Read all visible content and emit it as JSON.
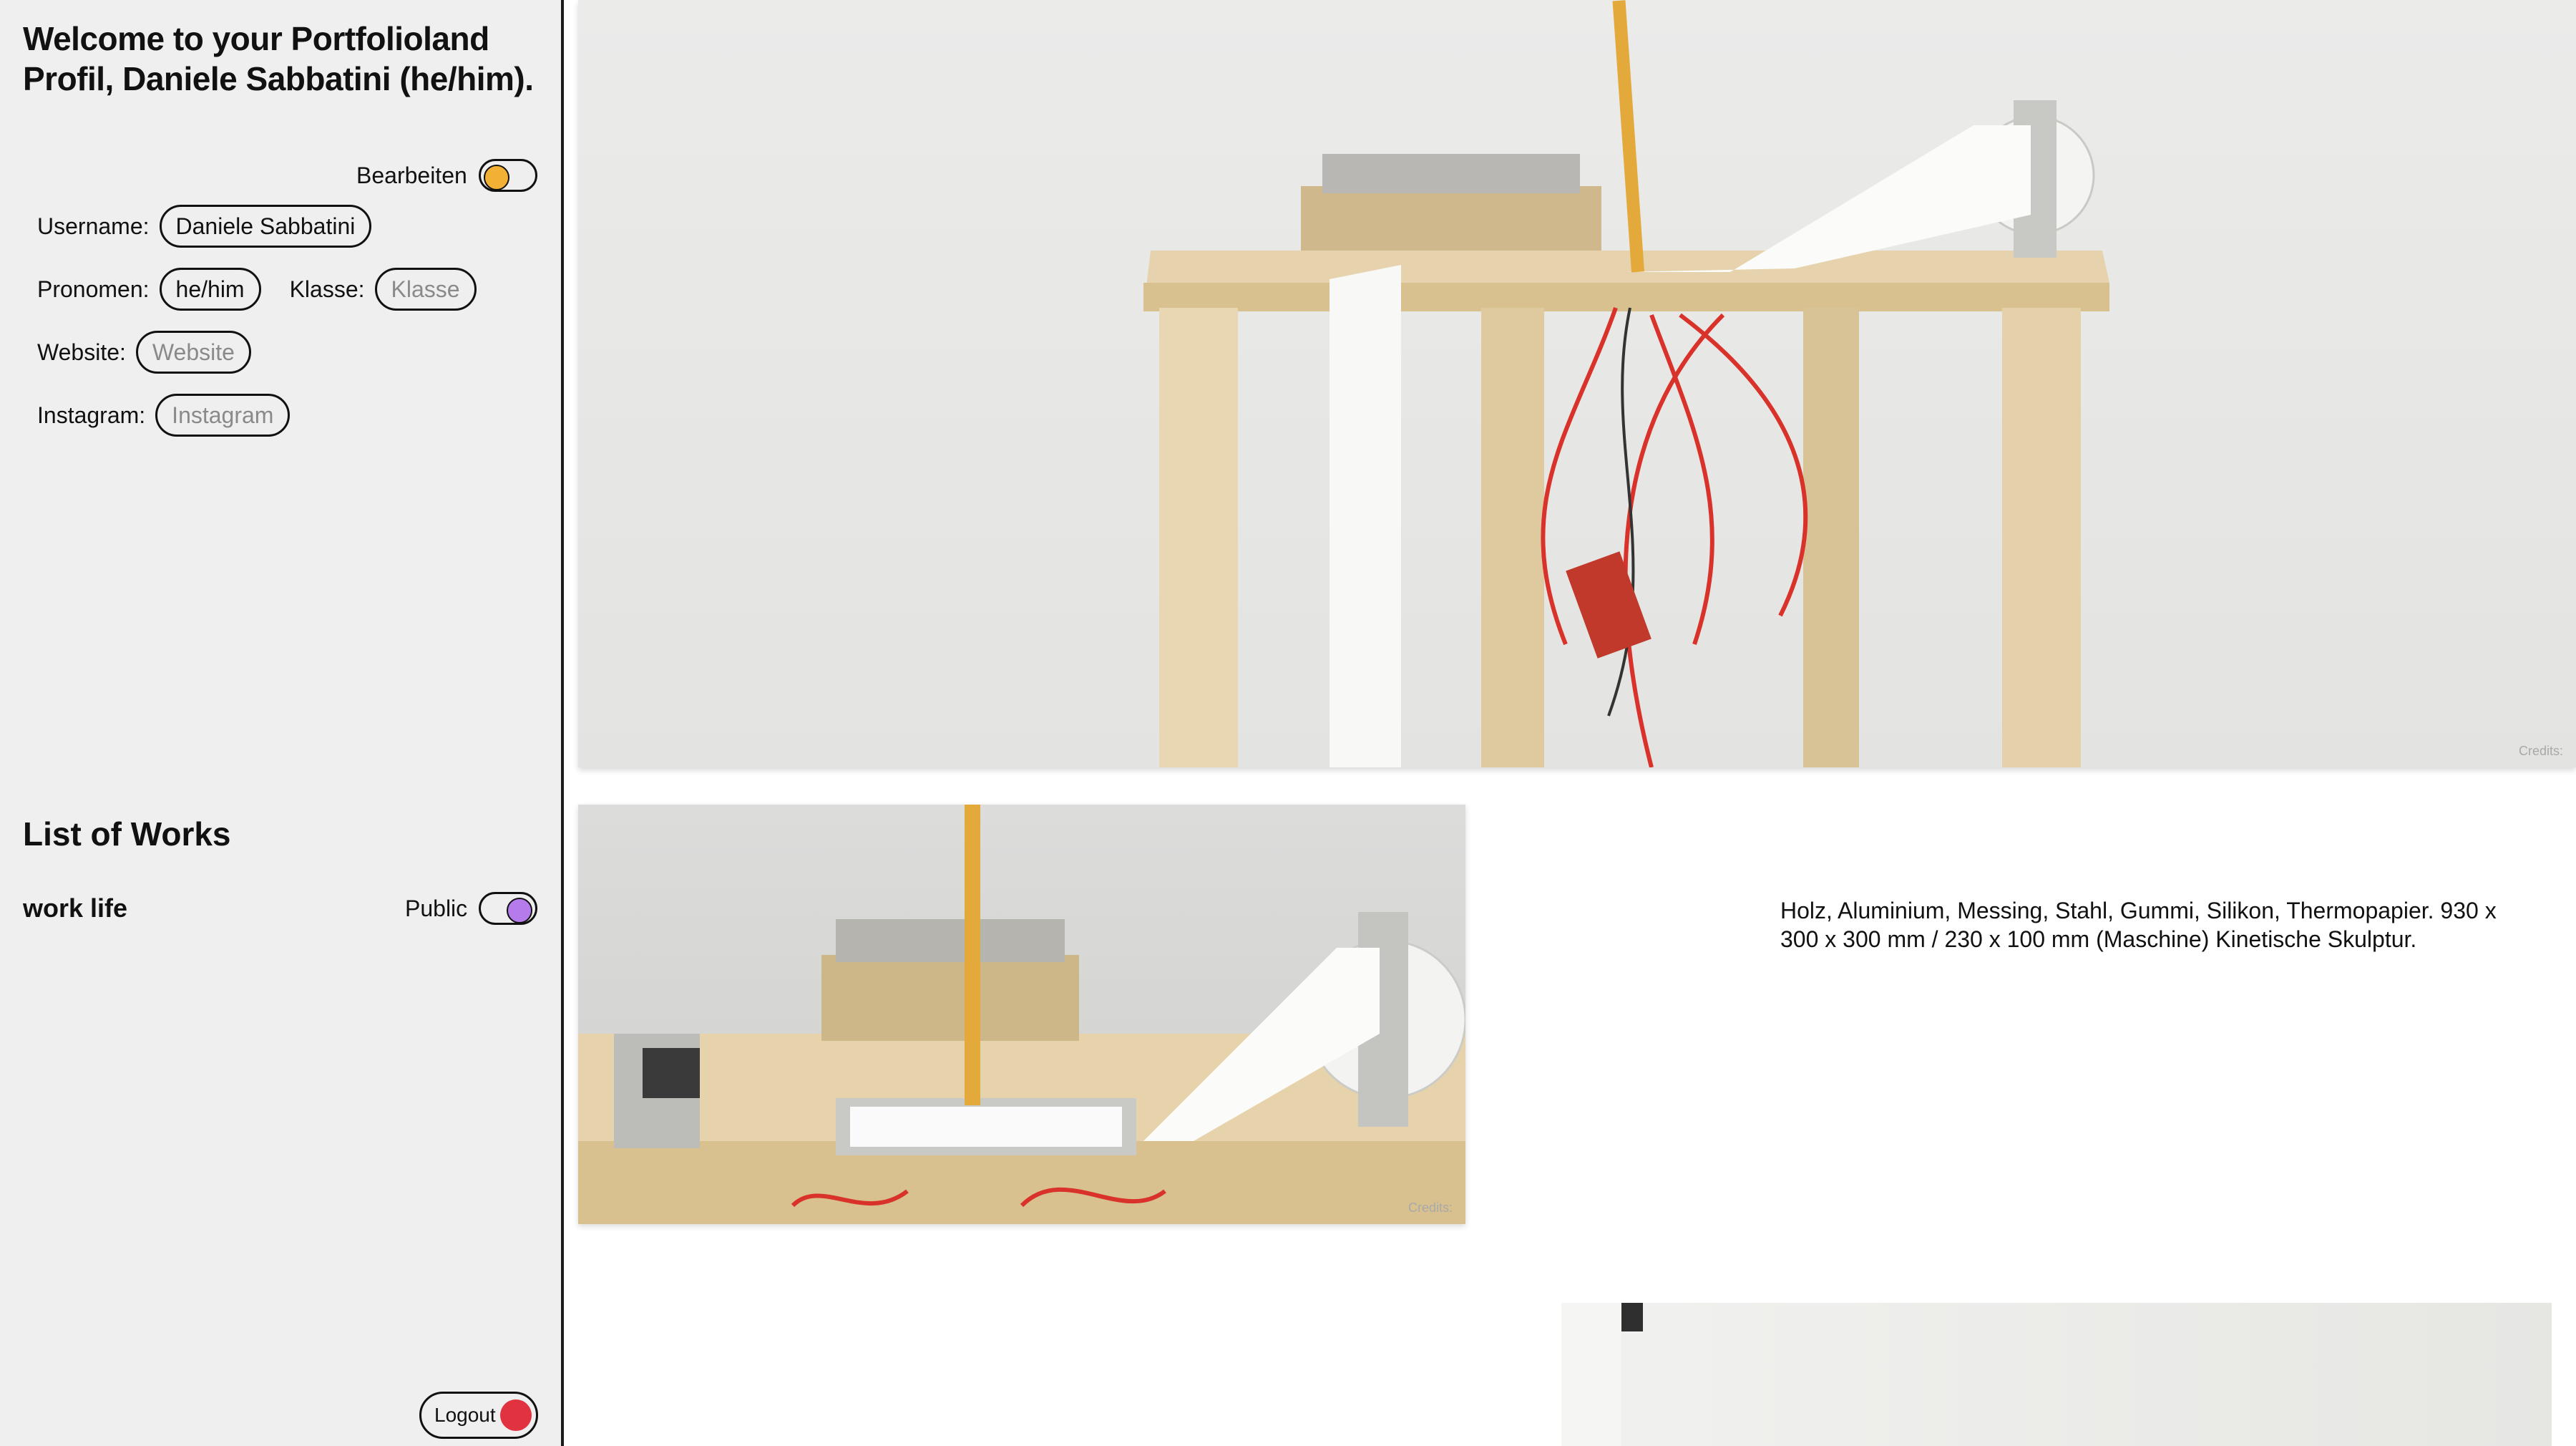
{
  "sidebar": {
    "welcome": "Welcome to your Portfolioland Profil, Daniele Sabbatini (he/him).",
    "edit_toggle": {
      "label": "Bearbeiten",
      "on": false,
      "knob_color": "#f2b134"
    },
    "fields": {
      "username": {
        "label": "Username:",
        "value": "Daniele Sabbatini"
      },
      "pronouns": {
        "label": "Pronomen:",
        "value": "he/him"
      },
      "klasse": {
        "label": "Klasse:",
        "placeholder": "Klasse"
      },
      "website": {
        "label": "Website:",
        "placeholder": "Website"
      },
      "instagram": {
        "label": "Instagram:",
        "placeholder": "Instagram"
      }
    },
    "list_title": "List of Works",
    "works": [
      {
        "title": "work life",
        "public_label": "Public",
        "public": true,
        "knob_color": "#b57bea"
      }
    ],
    "logout_label": "Logout",
    "logout_color": "#e0333f"
  },
  "main": {
    "hero_image": {
      "alt": "Kinetic sculpture machine on wooden table with thermal paper roll and red wires",
      "credits": "Credits:"
    },
    "detail_image": {
      "alt": "Close-up of pen plotting on thermal paper",
      "credits": "Credits:"
    },
    "description": "Holz, Aluminium, Messing, Stahl, Gummi, Silikon, Thermopapier. 930 x 300 x 300 mm / 230 x 100 mm (Maschine) Kinetische Skulptur.",
    "third_image": {
      "alt": "Artwork image (partially visible)"
    }
  }
}
